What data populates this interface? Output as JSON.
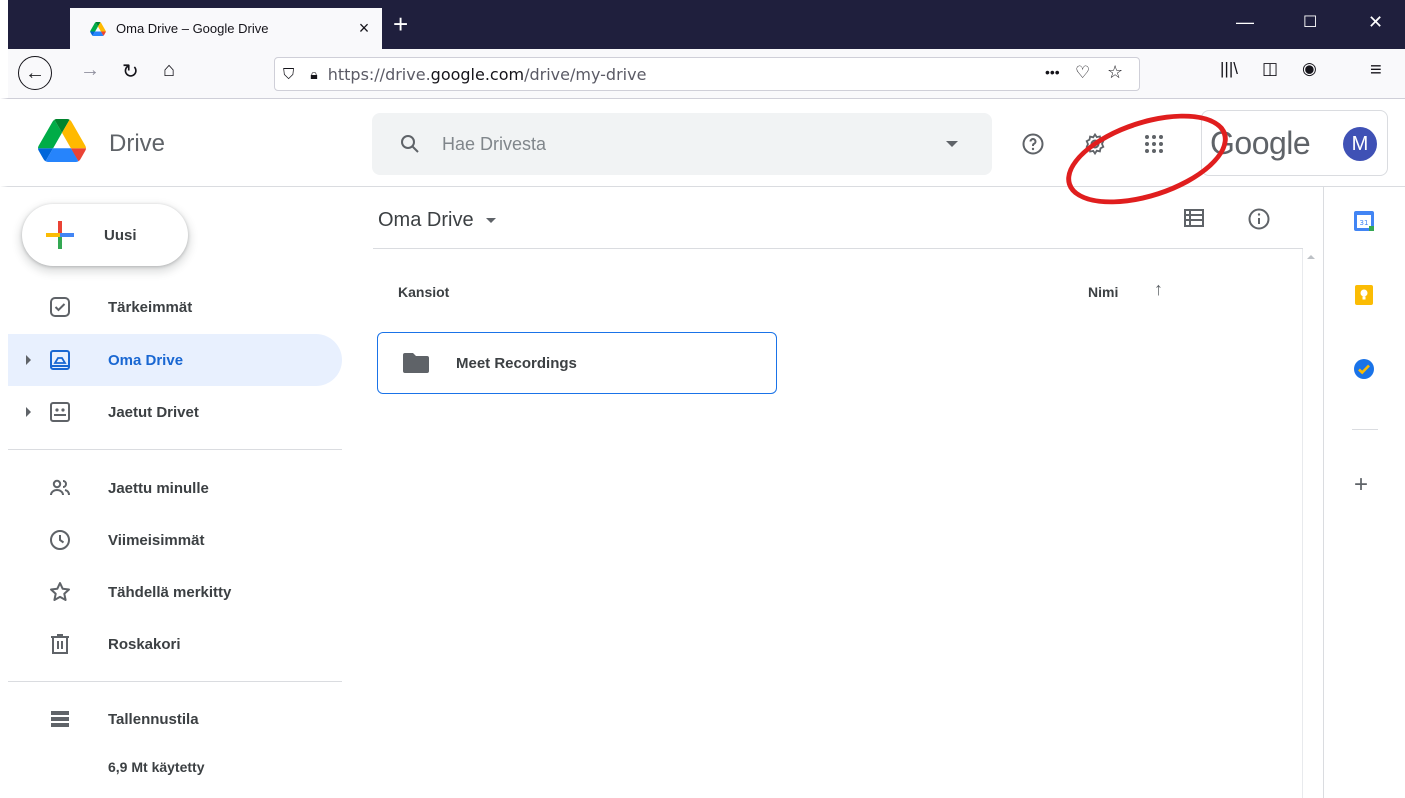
{
  "browser": {
    "tab_title": "Oma Drive – Google Drive",
    "tab_close": "×",
    "new_tab": "+",
    "url_prefix": "https://drive.",
    "url_domain": "google.com",
    "url_path": "/drive/my-drive",
    "url_more": "•••"
  },
  "header": {
    "app_name": "Drive",
    "search_placeholder": "Hae Drivesta",
    "google_word": "Google",
    "avatar_letter": "M"
  },
  "sidebar": {
    "new_button": "Uusi",
    "items": [
      {
        "label": "Tärkeimmät"
      },
      {
        "label": "Oma Drive"
      },
      {
        "label": "Jaetut Drivet"
      },
      {
        "label": "Jaettu minulle"
      },
      {
        "label": "Viimeisimmät"
      },
      {
        "label": "Tähdellä merkitty"
      },
      {
        "label": "Roskakori"
      },
      {
        "label": "Tallennustila"
      }
    ],
    "storage_used": "6,9 Mt käytetty"
  },
  "main": {
    "title": "Oma Drive",
    "section_label": "Kansiot",
    "sort_label": "Nimi",
    "sort_arrow": "↑",
    "folders": [
      {
        "name": "Meet Recordings"
      }
    ]
  },
  "colors": {
    "accent": "#1a73e8",
    "active_bg": "#e8f0fe",
    "titlebar": "#1f1f3d",
    "annotation": "#e01e1e"
  }
}
